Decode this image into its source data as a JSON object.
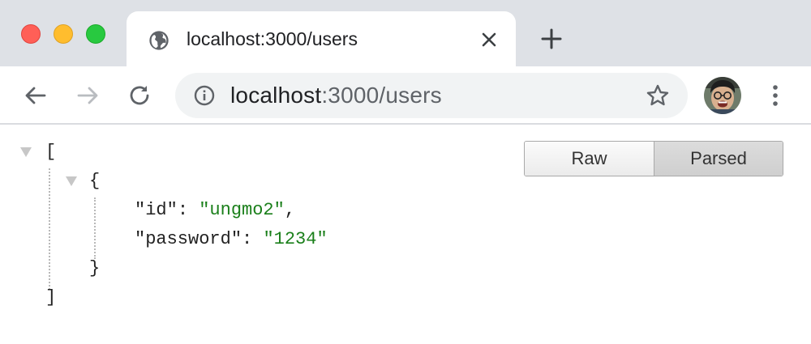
{
  "tab": {
    "title": "localhost:3000/users",
    "favicon": "globe-icon"
  },
  "omnibox": {
    "host": "localhost",
    "rest": ":3000/users"
  },
  "colors": {
    "tabstrip": "#dee1e6",
    "close_red": "#ff5f57",
    "minimize_yellow": "#ffbd2e",
    "maximize_green": "#28c940",
    "json_string": "#1a7f1a"
  },
  "json_viewer": {
    "open_bracket": "[",
    "close_bracket": "]",
    "open_brace": "{",
    "close_brace": "}",
    "entries": [
      {
        "key": "\"id\"",
        "sep": ": ",
        "value": "\"ungmo2\"",
        "trail": ","
      },
      {
        "key": "\"password\"",
        "sep": ": ",
        "value": "\"1234\"",
        "trail": ""
      }
    ],
    "view_toggle": {
      "raw": "Raw",
      "parsed": "Parsed",
      "selected": "Parsed"
    }
  }
}
